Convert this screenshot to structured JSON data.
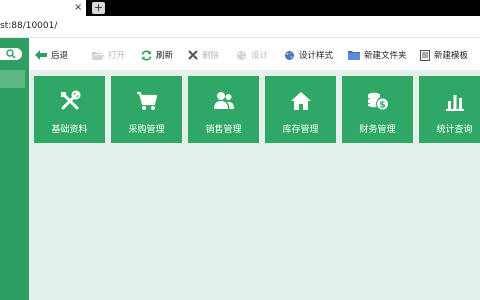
{
  "browser": {
    "tab_close_glyph": "×",
    "new_tab_glyph": "+",
    "url": "st:88/10001/"
  },
  "toolbar": {
    "back": "后退",
    "open": "打开",
    "refresh": "刷新",
    "delete": "删除",
    "design": "设计",
    "design_style": "设计样式",
    "new_folder": "新建文件夹",
    "new_template": "新建模板"
  },
  "tiles": [
    {
      "label": "基础资料",
      "icon": "tools-icon"
    },
    {
      "label": "采购管理",
      "icon": "cart-icon"
    },
    {
      "label": "销售管理",
      "icon": "users-icon"
    },
    {
      "label": "库存管理",
      "icon": "home-icon"
    },
    {
      "label": "财务管理",
      "icon": "coins-icon"
    },
    {
      "label": "统计查询",
      "icon": "bar-chart-icon"
    }
  ],
  "colors": {
    "brand_green": "#2f9e63",
    "tile_green": "#2fa866",
    "content_bg": "#e3f1ea",
    "disabled_gray": "#b8b8b8"
  }
}
